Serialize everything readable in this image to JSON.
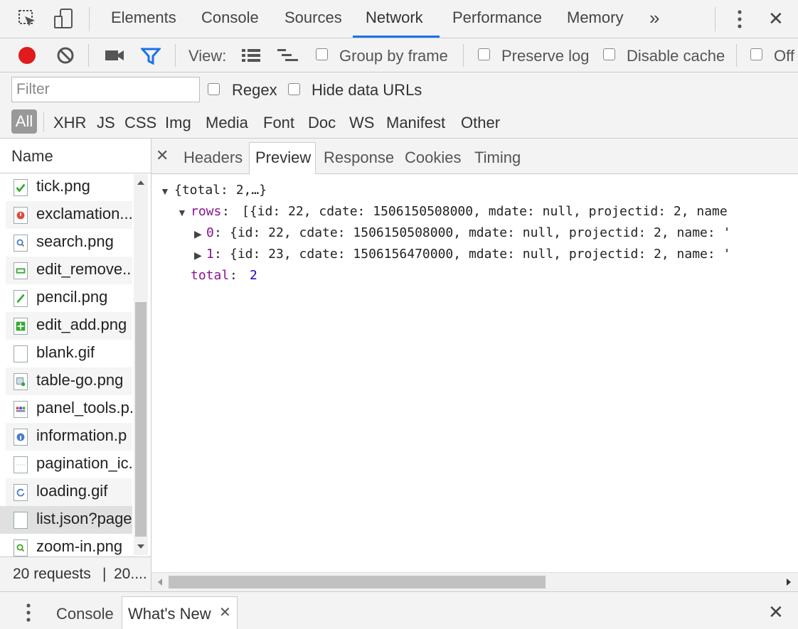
{
  "main_tabs": [
    "Elements",
    "Console",
    "Sources",
    "Network",
    "Performance",
    "Memory"
  ],
  "more_tabs_glyph": "»",
  "close_glyph": "✕",
  "toolbar": {
    "view_label": "View:",
    "group_by_frame": "Group by frame",
    "preserve_log": "Preserve log",
    "disable_cache": "Disable cache",
    "offline_partial": "Off"
  },
  "filter": {
    "placeholder": "Filter",
    "regex": "Regex",
    "hide_data_urls": "Hide data URLs",
    "types": [
      "All",
      "XHR",
      "JS",
      "CSS",
      "Img",
      "Media",
      "Font",
      "Doc",
      "WS",
      "Manifest",
      "Other"
    ],
    "active_type": "All"
  },
  "requests": {
    "header": "Name",
    "items": [
      {
        "name": "tick.png",
        "icon": "tick-icon"
      },
      {
        "name": "exclamation...",
        "icon": "exclamation-icon"
      },
      {
        "name": "search.png",
        "icon": "search-icon"
      },
      {
        "name": "edit_remove...",
        "icon": "edit-remove-icon"
      },
      {
        "name": "pencil.png",
        "icon": "pencil-icon"
      },
      {
        "name": "edit_add.png",
        "icon": "edit-add-icon"
      },
      {
        "name": "blank.gif",
        "icon": "blank-icon"
      },
      {
        "name": "table-go.png",
        "icon": "table-go-icon"
      },
      {
        "name": "panel_tools.p.",
        "icon": "panel-tools-icon"
      },
      {
        "name": "information.p",
        "icon": "information-icon"
      },
      {
        "name": "pagination_ic.",
        "icon": "pagination-icon"
      },
      {
        "name": "loading.gif",
        "icon": "loading-icon"
      },
      {
        "name": "list.json?page",
        "icon": "json-file-icon"
      },
      {
        "name": "zoom-in.png",
        "icon": "zoom-in-icon"
      }
    ],
    "selected_index": 12,
    "status_text": "20 requests",
    "status_divider": "|",
    "status_transfer": "20...."
  },
  "detail": {
    "close_glyph": "✕",
    "tabs": [
      "Headers",
      "Preview",
      "Response",
      "Cookies",
      "Timing"
    ],
    "active_tab": "Preview",
    "preview": {
      "root_summary": "{total: 2,…}",
      "rows_key": "rows",
      "rows_summary": "[{id: 22, cdate: 1506150508000, mdate: null, projectid: 2, name",
      "row0_key": "0",
      "row0_summary": "{id: 22, cdate: 1506150508000, mdate: null, projectid: 2, name: '",
      "row1_key": "1",
      "row1_summary": "{id: 23, cdate: 1506156470000, mdate: null, projectid: 2, name: '",
      "total_key": "total",
      "total_value": "2"
    }
  },
  "drawer": {
    "tabs": [
      "Console",
      "What's New"
    ],
    "active_tab": "What's New",
    "close_glyph": "✕"
  },
  "colors": {
    "record": "#e01b1b",
    "accent": "#1a73e8",
    "key": "#881391",
    "number": "#1c00cf"
  }
}
